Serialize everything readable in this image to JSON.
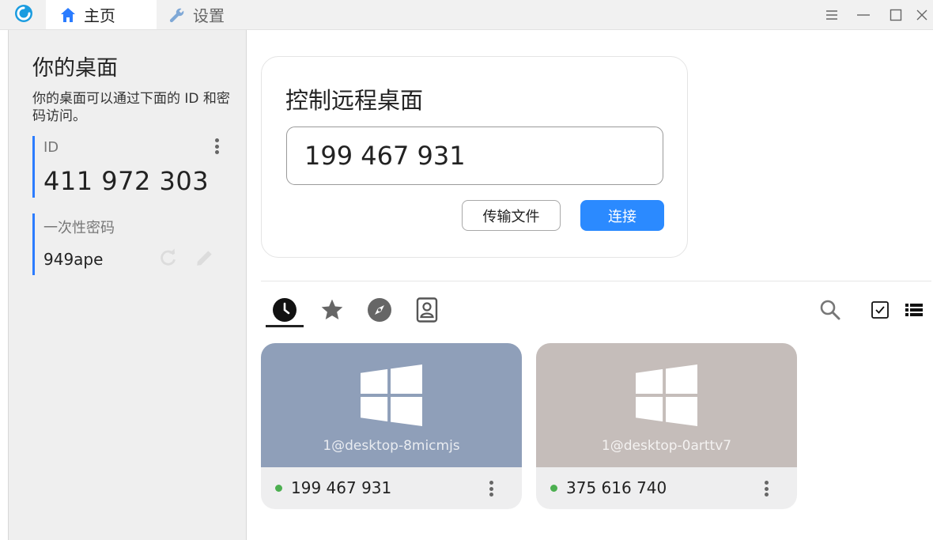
{
  "titlebar": {
    "tabs": [
      {
        "label": "主页",
        "icon": "home-icon",
        "active": true
      },
      {
        "label": "设置",
        "icon": "wrench-icon",
        "active": false
      }
    ]
  },
  "left_panel": {
    "title": "你的桌面",
    "description": "你的桌面可以通过下面的 ID 和密码访问。",
    "id_label": "ID",
    "id_value": "411 972 303",
    "password_label": "一次性密码",
    "password_value": "949ape"
  },
  "control": {
    "title": "控制远程桌面",
    "remote_id_value": "199 467 931",
    "transfer_button": "传输文件",
    "connect_button": "连接"
  },
  "peer_tabs": [
    {
      "name": "recent",
      "icon": "clock-icon",
      "active": true
    },
    {
      "name": "favorites",
      "icon": "star-icon",
      "active": false
    },
    {
      "name": "discovered",
      "icon": "compass-icon",
      "active": false
    },
    {
      "name": "address-book",
      "icon": "contact-book-icon",
      "active": false
    }
  ],
  "peers": [
    {
      "hostname": "1@desktop-8micmjs",
      "id": "199 467 931",
      "online": true,
      "color": "#8f9fb9",
      "os": "windows"
    },
    {
      "hostname": "1@desktop-0arttv7",
      "id": "375 616 740",
      "online": true,
      "color": "#c5bdba",
      "os": "windows"
    }
  ],
  "colors": {
    "accent": "#2b8aff",
    "id_bar": "#2b7cff",
    "online": "#4caf50"
  }
}
